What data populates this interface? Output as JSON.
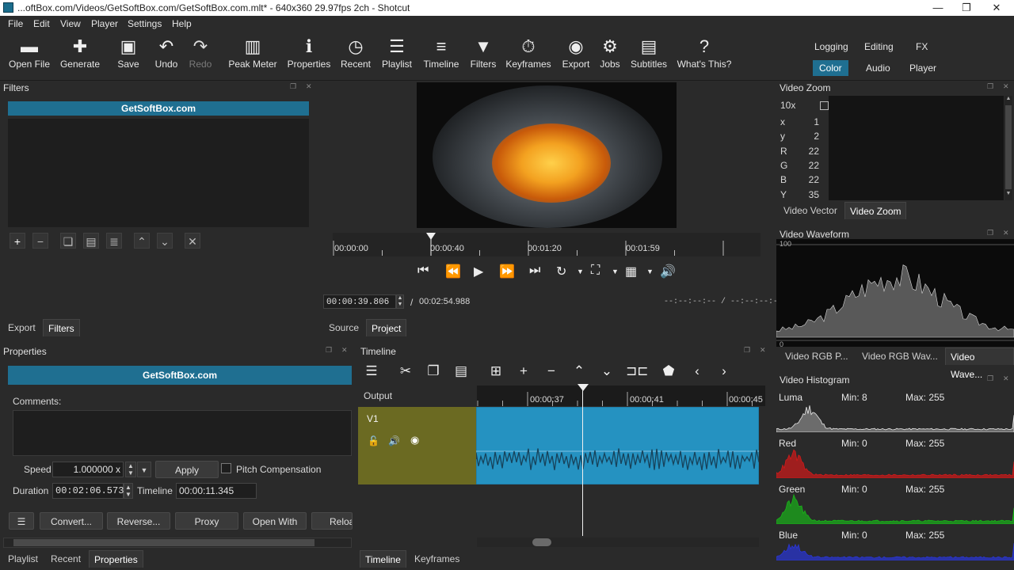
{
  "window": {
    "title": "...oftBox.com/Videos/GetSoftBox.com/GetSoftBox.com.mlt* - 640x360 29.97fps 2ch - Shotcut",
    "minimize": "—",
    "maximize": "❐",
    "close": "✕"
  },
  "menu": {
    "file": "File",
    "edit": "Edit",
    "view": "View",
    "player": "Player",
    "settings": "Settings",
    "help": "Help"
  },
  "toolbar": {
    "open_file": "Open File",
    "generate": "Generate",
    "save": "Save",
    "undo": "Undo",
    "redo": "Redo",
    "peak_meter": "Peak Meter",
    "properties": "Properties",
    "recent": "Recent",
    "playlist": "Playlist",
    "timeline": "Timeline",
    "filters": "Filters",
    "keyframes": "Keyframes",
    "export": "Export",
    "jobs": "Jobs",
    "subtitles": "Subtitles",
    "whats_this": "What's This?"
  },
  "layouts": {
    "logging": "Logging",
    "editing": "Editing",
    "fx": "FX",
    "color": "Color",
    "audio": "Audio",
    "player": "Player"
  },
  "filters_panel": {
    "title": "Filters",
    "clip_name": "GetSoftBox.com"
  },
  "left_tabs": {
    "export": "Export",
    "filters": "Filters"
  },
  "properties_panel": {
    "title": "Properties",
    "clip_name": "GetSoftBox.com",
    "comments_label": "Comments:",
    "speed_label": "Speed",
    "speed_value": "1.000000 x",
    "apply": "Apply",
    "pitch_label": "Pitch Compensation",
    "duration_label": "Duration",
    "duration_value": "00:02:06.573",
    "timeline_label": "Timeline",
    "timeline_value": "00:00:11.345",
    "convert": "Convert...",
    "reverse": "Reverse...",
    "proxy": "Proxy",
    "open_with": "Open With",
    "reload": "Reloa"
  },
  "bottom_left_tabs": {
    "playlist": "Playlist",
    "recent": "Recent",
    "properties": "Properties"
  },
  "player": {
    "ruler": [
      "00:00:00",
      "00:00:40",
      "00:01:20",
      "00:01:59"
    ],
    "position": "00:00:39.806",
    "separator": "/",
    "duration": "00:02:54.988",
    "in_out": "--:--:--:-- / --:--:--:--",
    "playhead_fraction": 0.228
  },
  "player_tabs": {
    "source": "Source",
    "project": "Project"
  },
  "timeline_panel": {
    "title": "Timeline",
    "output": "Output",
    "track": "V1",
    "ruler": [
      "00:00:37",
      "00:00:41",
      "00:00:45"
    ]
  },
  "bottom_center_tabs": {
    "timeline": "Timeline",
    "keyframes": "Keyframes"
  },
  "video_zoom": {
    "title": "Video Zoom",
    "zoom": "10x",
    "readouts": [
      [
        "x",
        "1"
      ],
      [
        "y",
        "2"
      ],
      [
        "R",
        "22"
      ],
      [
        "G",
        "22"
      ],
      [
        "B",
        "22"
      ],
      [
        "Y",
        "35"
      ]
    ],
    "tabs": {
      "vector": "Video Vector",
      "zoom": "Video Zoom"
    }
  },
  "waveform": {
    "title": "Video Waveform",
    "top": "100",
    "bottom": "0",
    "tabs": {
      "rgb_parade": "Video RGB P...",
      "rgb_wave": "Video RGB Wav...",
      "wave": "Video Wave..."
    }
  },
  "histogram": {
    "title": "Video Histogram",
    "rows": [
      {
        "name": "Luma",
        "min": "Min: 8",
        "max": "Max: 255",
        "color": "#e8e8e8"
      },
      {
        "name": "Red",
        "min": "Min: 0",
        "max": "Max: 255",
        "color": "#d21a1a"
      },
      {
        "name": "Green",
        "min": "Min: 0",
        "max": "Max: 255",
        "color": "#19b319"
      },
      {
        "name": "Blue",
        "min": "Min: 0",
        "max": "Max: 255",
        "color": "#2a36d8"
      }
    ]
  },
  "colors": {
    "accent": "#1f6f91",
    "clip": "#2592c1",
    "track_head": "#6b6a22"
  }
}
